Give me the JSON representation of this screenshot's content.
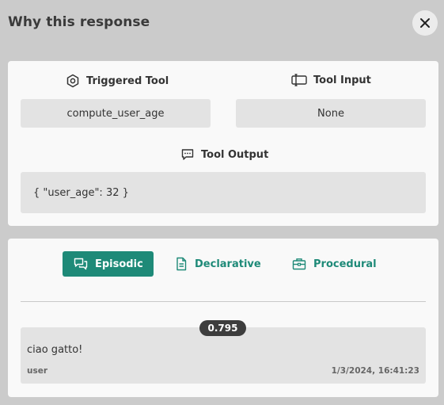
{
  "header": {
    "title": "Why this response"
  },
  "tool": {
    "triggered_label": "Triggered Tool",
    "triggered_value": "compute_user_age",
    "input_label": "Tool Input",
    "input_value": "None",
    "output_label": "Tool Output",
    "output_value": "{ \"user_age\": 32 }"
  },
  "memory": {
    "tabs": [
      {
        "label": "Episodic",
        "icon": "chat-bubbles-icon",
        "active": true
      },
      {
        "label": "Declarative",
        "icon": "document-icon",
        "active": false
      },
      {
        "label": "Procedural",
        "icon": "toolbox-icon",
        "active": false
      }
    ],
    "items": [
      {
        "score": "0.795",
        "text": "ciao gatto!",
        "role": "user",
        "timestamp": "1/3/2024, 16:41:23"
      }
    ]
  },
  "colors": {
    "background": "#cbcbcb",
    "card": "#f9f9f9",
    "field": "#e3e3e3",
    "accent": "#1e8a78",
    "badge": "#3d3d3d"
  }
}
